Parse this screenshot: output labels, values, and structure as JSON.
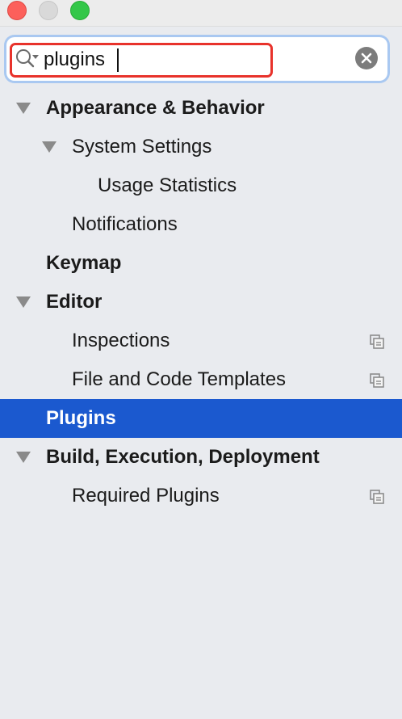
{
  "window": {
    "controls": [
      "close",
      "minimize",
      "maximize"
    ]
  },
  "search": {
    "value": "plugins",
    "icon": "search-icon",
    "clear_icon": "clear-icon"
  },
  "colors": {
    "selection": "#1b59cf",
    "highlight_border": "#e8322b",
    "background": "#e9ebef"
  },
  "tree": [
    {
      "label": "Appearance & Behavior",
      "level": 0,
      "bold": true,
      "expanded": true,
      "project_icon": false,
      "selected": false
    },
    {
      "label": "System Settings",
      "level": 1,
      "bold": false,
      "expanded": true,
      "project_icon": false,
      "selected": false
    },
    {
      "label": "Usage Statistics",
      "level": 2,
      "bold": false,
      "expanded": null,
      "project_icon": false,
      "selected": false
    },
    {
      "label": "Notifications",
      "level": 1,
      "bold": false,
      "expanded": null,
      "project_icon": false,
      "selected": false
    },
    {
      "label": "Keymap",
      "level": 0,
      "bold": true,
      "expanded": null,
      "project_icon": false,
      "selected": false
    },
    {
      "label": "Editor",
      "level": 0,
      "bold": true,
      "expanded": true,
      "project_icon": false,
      "selected": false
    },
    {
      "label": "Inspections",
      "level": 1,
      "bold": false,
      "expanded": null,
      "project_icon": true,
      "selected": false
    },
    {
      "label": "File and Code Templates",
      "level": 1,
      "bold": false,
      "expanded": null,
      "project_icon": true,
      "selected": false
    },
    {
      "label": "Plugins",
      "level": 0,
      "bold": true,
      "expanded": null,
      "project_icon": false,
      "selected": true
    },
    {
      "label": "Build, Execution, Deployment",
      "level": 0,
      "bold": true,
      "expanded": true,
      "project_icon": false,
      "selected": false
    },
    {
      "label": "Required Plugins",
      "level": 1,
      "bold": false,
      "expanded": null,
      "project_icon": true,
      "selected": false
    }
  ]
}
